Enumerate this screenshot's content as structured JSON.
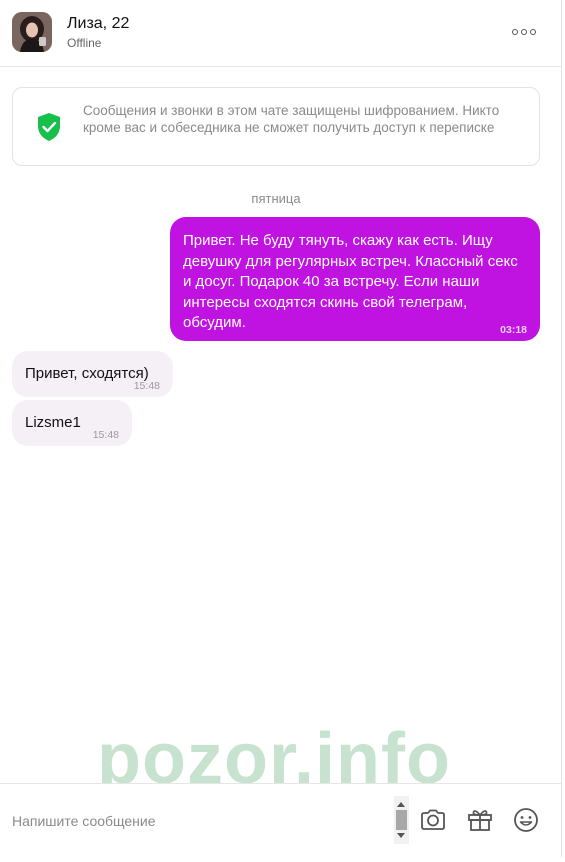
{
  "header": {
    "contact_name": "Лиза, 22",
    "contact_status": "Offline",
    "more_icon": "more-horizontal-icon"
  },
  "encryption_notice": {
    "icon": "shield-check-icon",
    "icon_color": "#17c04a",
    "text": "Сообщения и звонки в этом чате защищены шифрованием. Никто кроме вас и собеседника не сможет получить доступ к переписке"
  },
  "conversation": {
    "date_separator": "пятница",
    "messages": [
      {
        "direction": "outgoing",
        "text": "Привет. Не буду тянуть, скажу как есть. Ищу девушку для регулярных встреч. Классный секс и досуг. Подарок 40 за встречу. Если наши интересы сходятся скинь свой телеграм, обсудим.",
        "time": "03:18"
      },
      {
        "direction": "incoming",
        "text": "Привет, сходятся)",
        "time": "15:48"
      },
      {
        "direction": "incoming",
        "text": "Lizsme1",
        "time": "15:48"
      }
    ]
  },
  "watermark": "pozor.info",
  "composer": {
    "placeholder": "Напишите сообщение",
    "value": "",
    "buttons": [
      "camera-icon",
      "gift-icon",
      "emoji-icon"
    ]
  },
  "colors": {
    "outgoing_bubble": "#c012e0",
    "incoming_bubble": "#f5f0f6",
    "watermark": "#c8e2d0"
  }
}
